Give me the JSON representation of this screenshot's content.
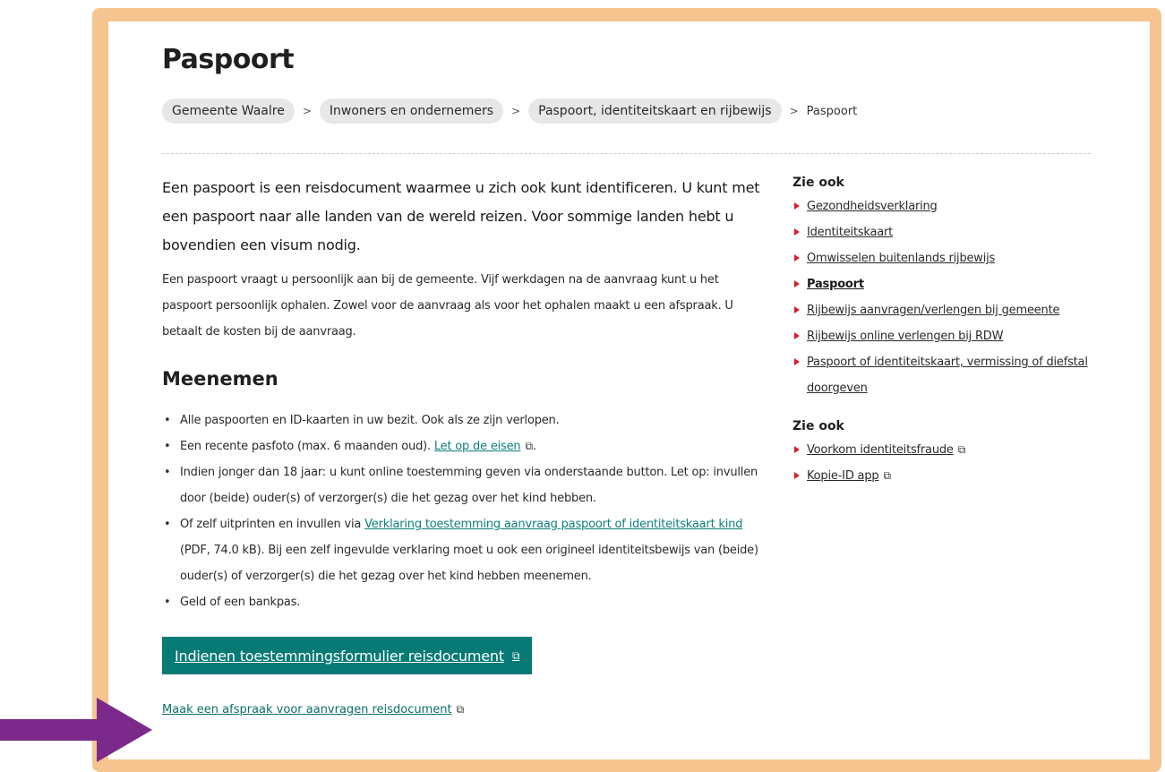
{
  "page": {
    "title": "Paspoort"
  },
  "breadcrumb": {
    "items": [
      "Gemeente Waalre",
      "Inwoners en ondernemers",
      "Paspoort, identiteitskaart en rijbewijs"
    ],
    "separator": ">",
    "current": "Paspoort"
  },
  "main": {
    "intro": "Een paspoort is een reisdocument waarmee u zich ook kunt identificeren. U kunt met een paspoort naar alle landen van de wereld reizen. Voor sommige landen hebt u bovendien een visum nodig.",
    "body": "Een paspoort vraagt u persoonlijk aan bij de gemeente. Vijf werkdagen na de aanvraag kunt u het paspoort persoonlijk ophalen. Zowel voor de aanvraag als voor het ophalen maakt u een afspraak. U betaalt de kosten bij de aanvraag.",
    "section_title": "Meenemen",
    "items": {
      "i1": "Alle paspoorten en ID-kaarten in uw bezit. Ook als ze zijn verlopen.",
      "i2_text": "Een recente pasfoto (max. 6 maanden oud). ",
      "i2_link": "Let op de eisen",
      "i2_end": ".",
      "i3": "Indien jonger dan 18 jaar: u kunt online toestemming geven via onderstaande button. Let op: invullen door (beide) ouder(s) of verzorger(s) die het gezag over het kind hebben.",
      "i4_text": "Of zelf uitprinten en invullen via ",
      "i4_link": "Verklaring toestemming aanvraag paspoort of identiteitskaart kind",
      "i4_end": " (PDF, 74.0 kB). Bij een zelf ingevulde verklaring moet u ook een origineel identiteitsbewijs van (beide) ouder(s) of verzorger(s) die het gezag over het kind hebben meenemen.",
      "i5": "Geld of een bankpas."
    },
    "cta_label": "Indienen toestemmingsformulier reisdocument",
    "bottom_link": "Maak een afspraak voor aanvragen reisdocument"
  },
  "aside": {
    "group1_title": "Zie ook",
    "group1": [
      "Gezondheidsverklaring",
      "Identiteitskaart",
      "Omwisselen buitenlands rijbewijs",
      "Paspoort",
      "Rijbewijs aanvragen/verlengen bij gemeente",
      "Rijbewijs online verlengen bij RDW",
      "Paspoort of identiteitskaart, vermissing of diefstal doorgeven"
    ],
    "group2_title": "Zie ook",
    "group2": [
      "Voorkom identiteitsfraude",
      "Kopie-ID app"
    ]
  },
  "icons": {
    "external_link": "external-link-icon",
    "list_marker": "triangle-right-icon",
    "annotation": "arrow-right-icon"
  },
  "colors": {
    "frame": "#f6c58f",
    "accent": "#087a75",
    "link": "#0b7f7a",
    "marker": "#d1202a",
    "arrow": "#7b2a8b"
  }
}
